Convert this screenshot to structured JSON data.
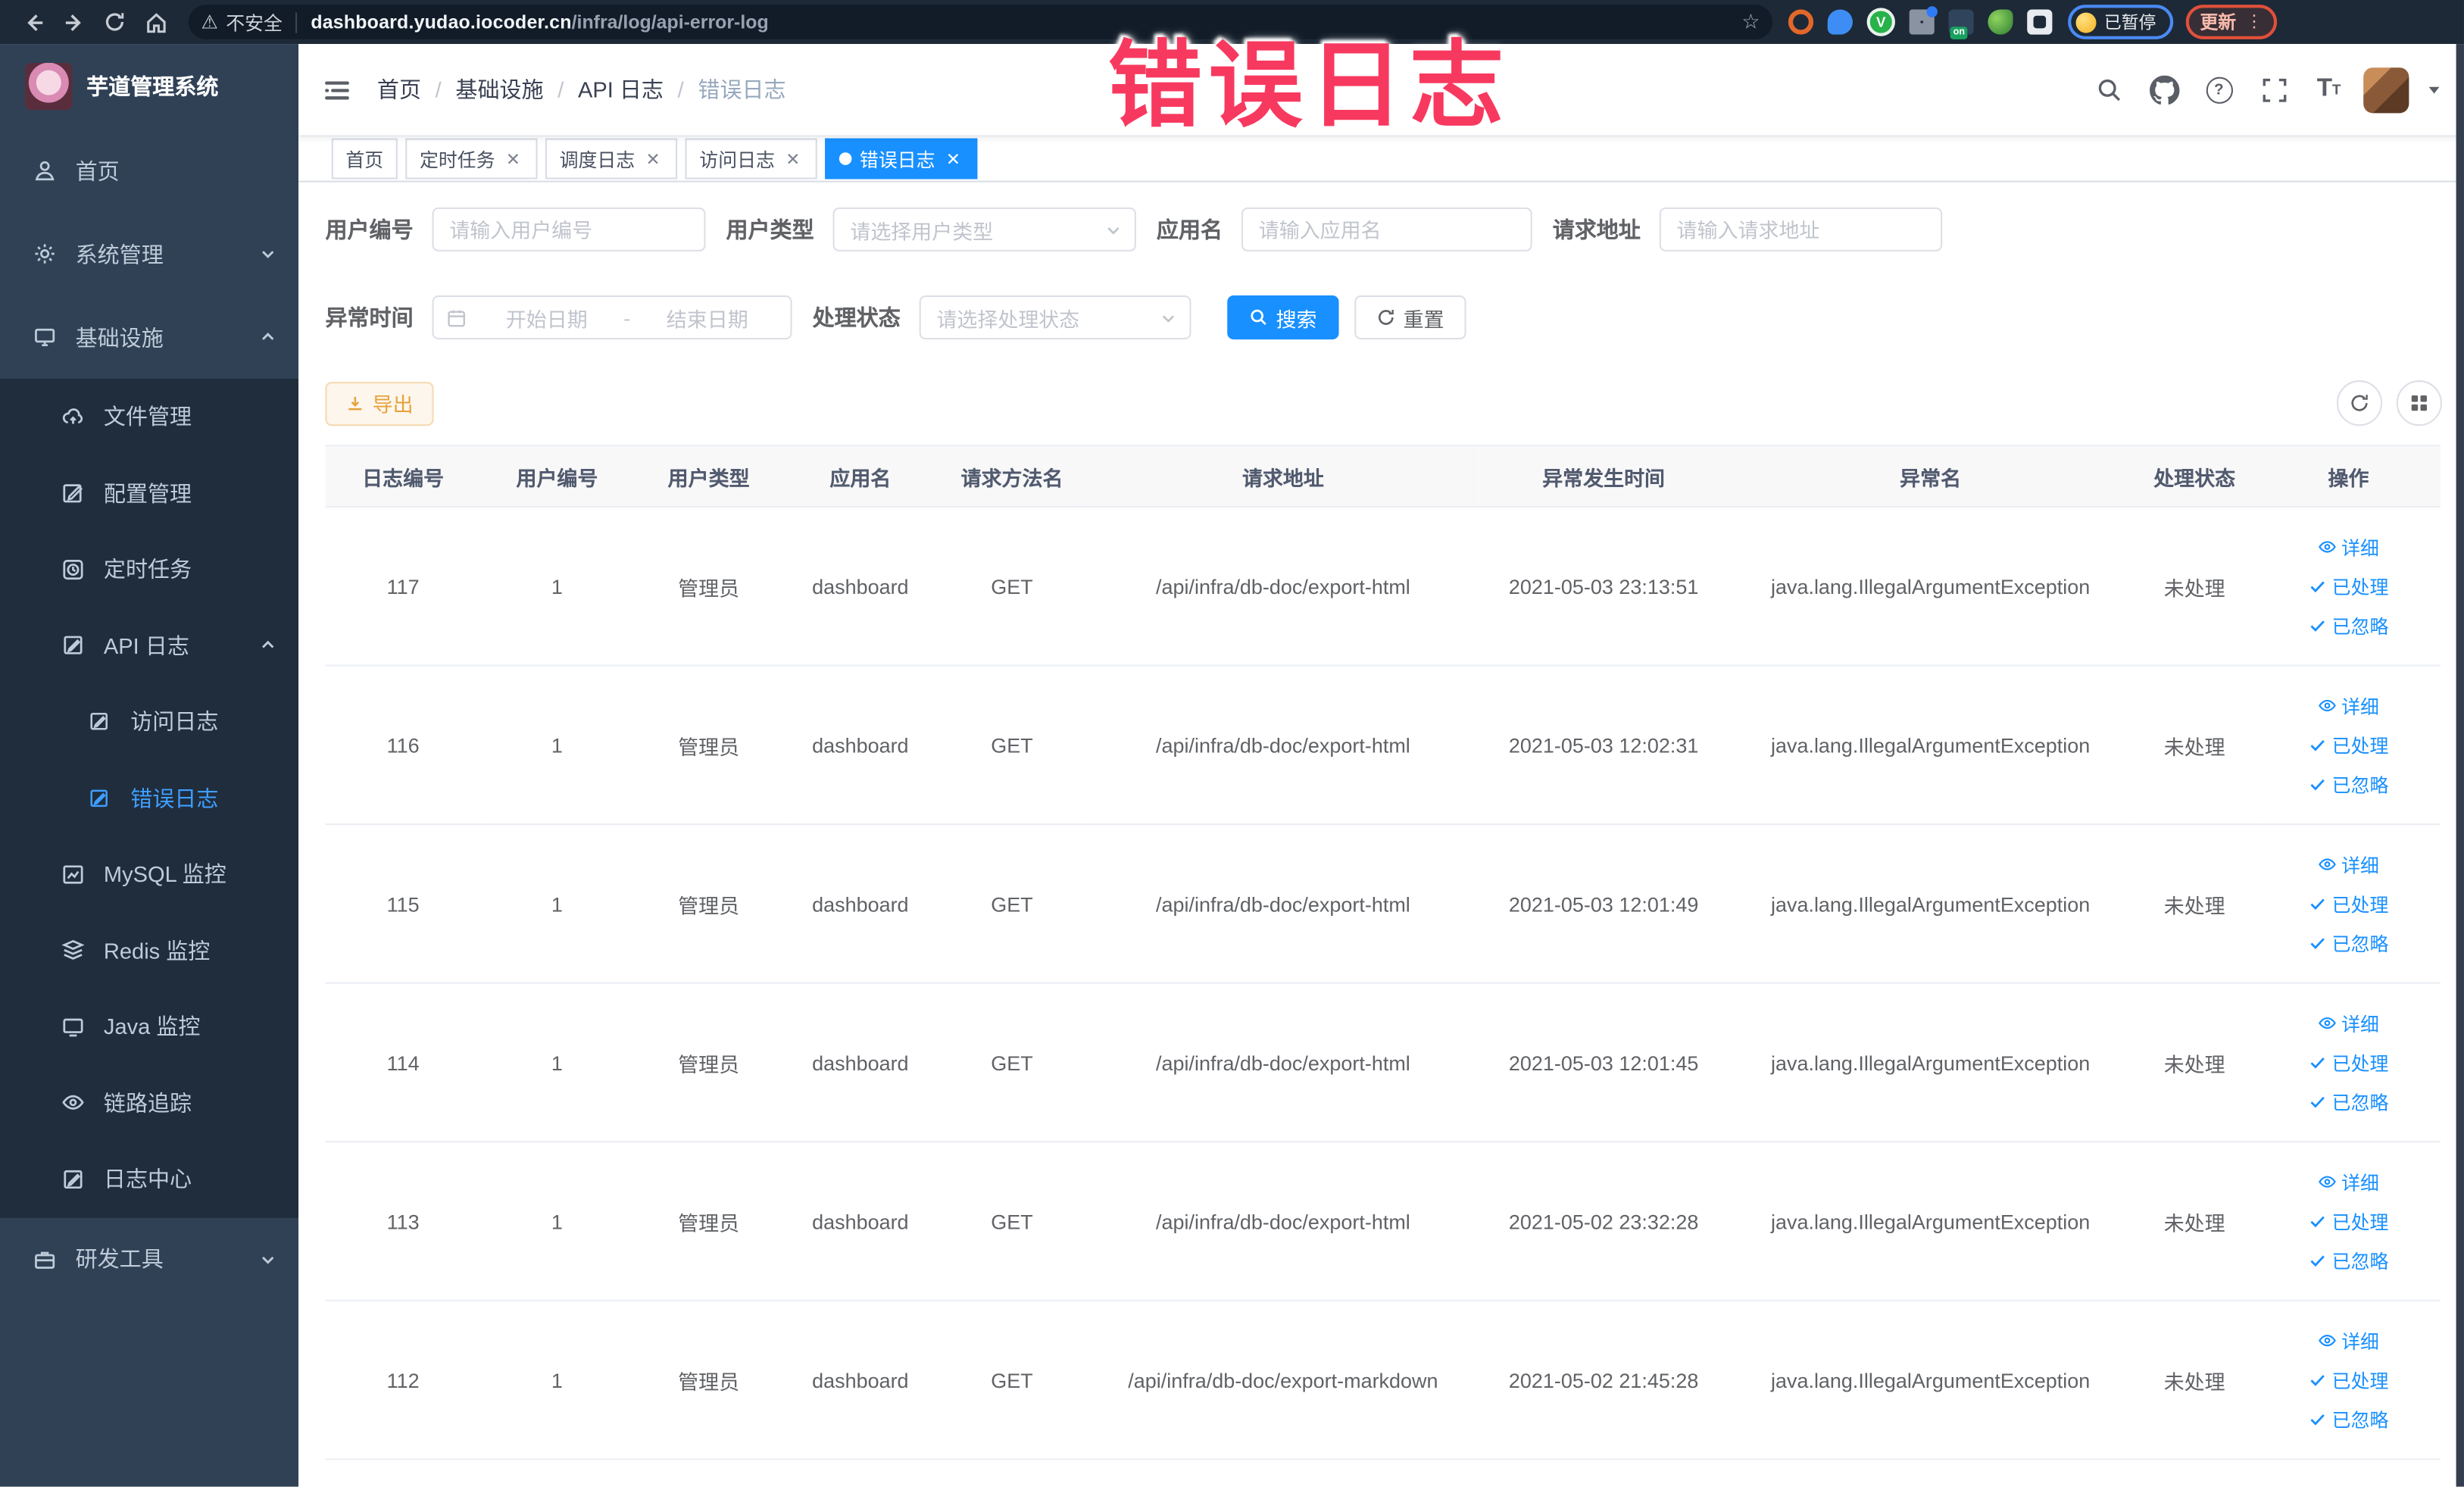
{
  "browser": {
    "security_label": "不安全",
    "url_domain": "dashboard.yudao.iocoder.cn",
    "url_path": "/infra/log/api-error-log",
    "ext_on_badge": "on",
    "profile_badge": "已暂停",
    "update_button": "更新"
  },
  "annotation": {
    "text": "错误日志"
  },
  "sidebar": {
    "title": "芋道管理系统",
    "items": [
      {
        "label": "首页"
      },
      {
        "label": "系统管理"
      },
      {
        "label": "基础设施"
      },
      {
        "label": "文件管理"
      },
      {
        "label": "配置管理"
      },
      {
        "label": "定时任务"
      },
      {
        "label": "API 日志"
      },
      {
        "label": "访问日志"
      },
      {
        "label": "错误日志"
      },
      {
        "label": "MySQL 监控"
      },
      {
        "label": "Redis 监控"
      },
      {
        "label": "Java 监控"
      },
      {
        "label": "链路追踪"
      },
      {
        "label": "日志中心"
      },
      {
        "label": "研发工具"
      }
    ]
  },
  "breadcrumb": {
    "separator": "/",
    "items": [
      "首页",
      "基础设施",
      "API 日志",
      "错误日志"
    ]
  },
  "tabs": [
    {
      "label": "首页"
    },
    {
      "label": "定时任务"
    },
    {
      "label": "调度日志"
    },
    {
      "label": "访问日志"
    },
    {
      "label": "错误日志"
    }
  ],
  "filters": {
    "user_id": {
      "label": "用户编号",
      "placeholder": "请输入用户编号"
    },
    "user_type": {
      "label": "用户类型",
      "placeholder": "请选择用户类型"
    },
    "app_name": {
      "label": "应用名",
      "placeholder": "请输入应用名"
    },
    "request_url": {
      "label": "请求地址",
      "placeholder": "请输入请求地址"
    },
    "exception_time": {
      "label": "异常时间",
      "start_placeholder": "开始日期",
      "separator": "-",
      "end_placeholder": "结束日期"
    },
    "process_status": {
      "label": "处理状态",
      "placeholder": "请选择处理状态"
    },
    "search_button": "搜索",
    "reset_button": "重置"
  },
  "toolbar": {
    "export_button": "导出"
  },
  "table": {
    "headers": [
      "日志编号",
      "用户编号",
      "用户类型",
      "应用名",
      "请求方法名",
      "请求地址",
      "异常发生时间",
      "异常名",
      "处理状态",
      "操作"
    ],
    "actions": {
      "detail": "详细",
      "processed": "已处理",
      "ignored": "已忽略"
    },
    "rows": [
      {
        "id": "117",
        "user_id": "1",
        "user_type": "管理员",
        "app": "dashboard",
        "method": "GET",
        "url": "/api/infra/db-doc/export-html",
        "time": "2021-05-03 23:13:51",
        "exception": "java.lang.IllegalArgumentException",
        "status": "未处理"
      },
      {
        "id": "116",
        "user_id": "1",
        "user_type": "管理员",
        "app": "dashboard",
        "method": "GET",
        "url": "/api/infra/db-doc/export-html",
        "time": "2021-05-03 12:02:31",
        "exception": "java.lang.IllegalArgumentException",
        "status": "未处理"
      },
      {
        "id": "115",
        "user_id": "1",
        "user_type": "管理员",
        "app": "dashboard",
        "method": "GET",
        "url": "/api/infra/db-doc/export-html",
        "time": "2021-05-03 12:01:49",
        "exception": "java.lang.IllegalArgumentException",
        "status": "未处理"
      },
      {
        "id": "114",
        "user_id": "1",
        "user_type": "管理员",
        "app": "dashboard",
        "method": "GET",
        "url": "/api/infra/db-doc/export-html",
        "time": "2021-05-03 12:01:45",
        "exception": "java.lang.IllegalArgumentException",
        "status": "未处理"
      },
      {
        "id": "113",
        "user_id": "1",
        "user_type": "管理员",
        "app": "dashboard",
        "method": "GET",
        "url": "/api/infra/db-doc/export-html",
        "time": "2021-05-02 23:32:28",
        "exception": "java.lang.IllegalArgumentException",
        "status": "未处理"
      },
      {
        "id": "112",
        "user_id": "1",
        "user_type": "管理员",
        "app": "dashboard",
        "method": "GET",
        "url": "/api/infra/db-doc/export-markdown",
        "time": "2021-05-02 21:45:28",
        "exception": "java.lang.IllegalArgumentException",
        "status": "未处理"
      }
    ]
  },
  "colors": {
    "primary": "#1890ff",
    "sidebar_bg": "#304156",
    "submenu_bg": "#1f2d3d",
    "active_text": "#409eff",
    "warning": "#e6a23c",
    "annotation": "#f8395f"
  }
}
